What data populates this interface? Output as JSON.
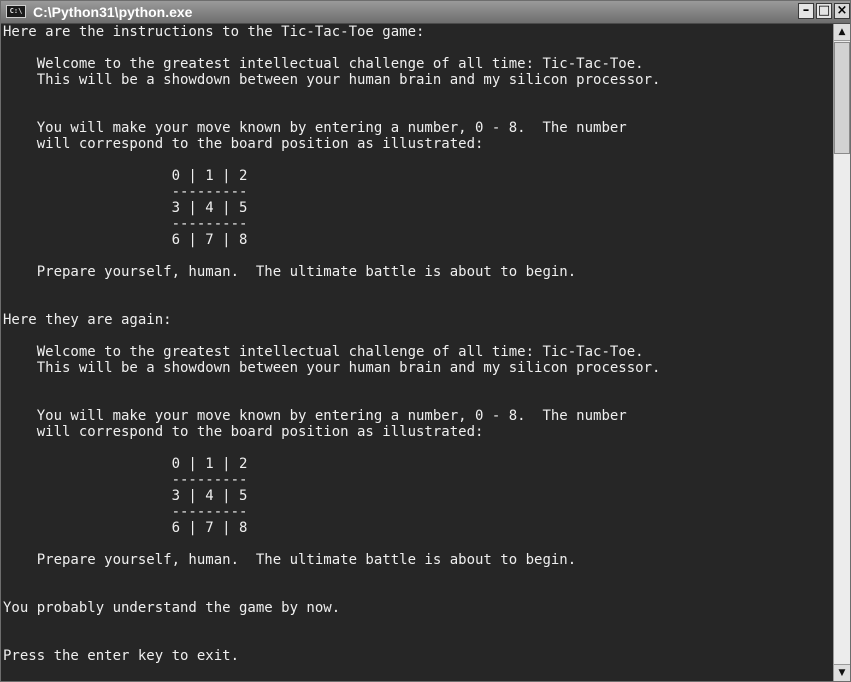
{
  "window": {
    "title": "C:\\Python31\\python.exe",
    "icon_label": "C:\\",
    "minimize_glyph": "–",
    "maximize_glyph": "□",
    "close_glyph": "×"
  },
  "console": {
    "lines": [
      "Here are the instructions to the Tic-Tac-Toe game:",
      "",
      "    Welcome to the greatest intellectual challenge of all time: Tic-Tac-Toe.",
      "    This will be a showdown between your human brain and my silicon processor.",
      "",
      "",
      "    You will make your move known by entering a number, 0 - 8.  The number",
      "    will correspond to the board position as illustrated:",
      "",
      "                    0 | 1 | 2",
      "                    ---------",
      "                    3 | 4 | 5",
      "                    ---------",
      "                    6 | 7 | 8",
      "",
      "    Prepare yourself, human.  The ultimate battle is about to begin.",
      "",
      "",
      "Here they are again:",
      "",
      "    Welcome to the greatest intellectual challenge of all time: Tic-Tac-Toe.",
      "    This will be a showdown between your human brain and my silicon processor.",
      "",
      "",
      "    You will make your move known by entering a number, 0 - 8.  The number",
      "    will correspond to the board position as illustrated:",
      "",
      "                    0 | 1 | 2",
      "                    ---------",
      "                    3 | 4 | 5",
      "                    ---------",
      "                    6 | 7 | 8",
      "",
      "    Prepare yourself, human.  The ultimate battle is about to begin.",
      "",
      "",
      "You probably understand the game by now.",
      "",
      "",
      "Press the enter key to exit."
    ]
  },
  "scrollbar": {
    "up_glyph": "▲",
    "down_glyph": "▼"
  }
}
